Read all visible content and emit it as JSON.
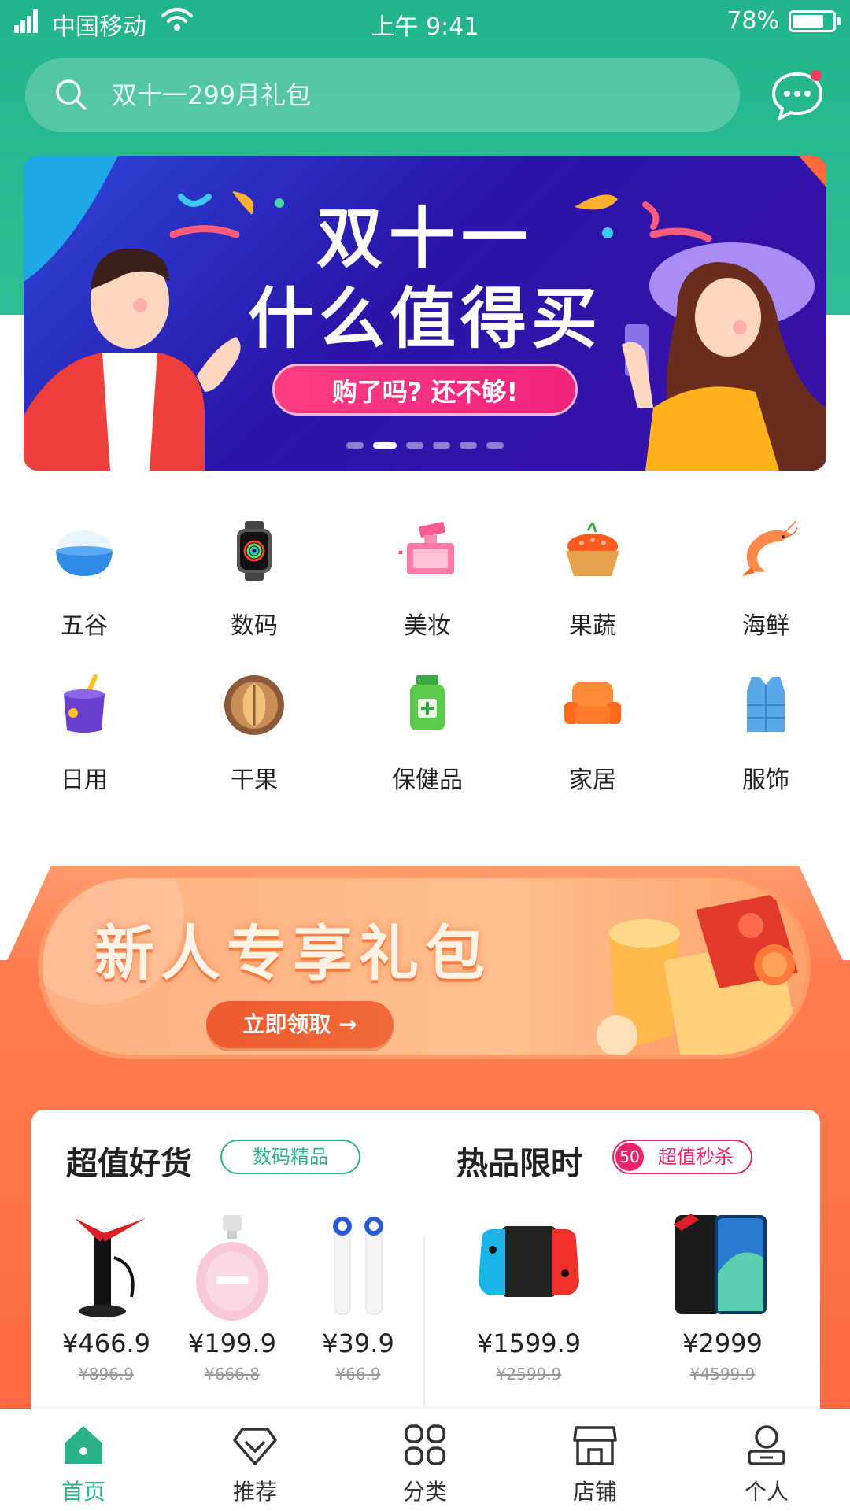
{
  "status_bar": {
    "carrier": "中国移动",
    "time": "上午 9:41",
    "battery": "78%"
  },
  "search": {
    "placeholder": "双十一299月礼包"
  },
  "banner": {
    "title": "双十一",
    "subtitle": "什么值得买",
    "button": "购了吗? 还不够!",
    "pages": 6,
    "active_page": 2
  },
  "categories": [
    {
      "label": "五谷",
      "icon": "rice-bowl-icon"
    },
    {
      "label": "数码",
      "icon": "smartwatch-icon"
    },
    {
      "label": "美妆",
      "icon": "perfume-icon"
    },
    {
      "label": "果蔬",
      "icon": "fruit-basket-icon"
    },
    {
      "label": "海鲜",
      "icon": "shrimp-icon"
    },
    {
      "label": "日用",
      "icon": "cup-icon"
    },
    {
      "label": "干果",
      "icon": "walnut-icon"
    },
    {
      "label": "保健品",
      "icon": "medicine-bottle-icon"
    },
    {
      "label": "家居",
      "icon": "sofa-icon"
    },
    {
      "label": "服饰",
      "icon": "vest-icon"
    }
  ],
  "promo": {
    "title": "新人专享礼包",
    "button": "立即领取 →"
  },
  "sections": {
    "left": {
      "title": "超值好货",
      "tag": "数码精品"
    },
    "right": {
      "title": "热品限时",
      "tag_badge": "50",
      "tag": "超值秒杀"
    }
  },
  "products": [
    {
      "price": "¥466.9",
      "old_price": "¥896.9"
    },
    {
      "price": "¥199.9",
      "old_price": "¥666.8"
    },
    {
      "price": "¥39.9",
      "old_price": "¥66.9"
    },
    {
      "price": "¥1599.9",
      "old_price": "¥2599.9"
    },
    {
      "price": "¥2999",
      "old_price": "¥4599.9"
    }
  ],
  "tabbar": {
    "items": [
      {
        "label": "首页",
        "icon": "home-icon",
        "active": true
      },
      {
        "label": "推荐",
        "icon": "diamond-icon",
        "active": false
      },
      {
        "label": "分类",
        "icon": "grid-icon",
        "active": false
      },
      {
        "label": "店铺",
        "icon": "store-icon",
        "active": false
      },
      {
        "label": "个人",
        "icon": "user-icon",
        "active": false
      }
    ]
  },
  "colors": {
    "brand_green": "#2bb28a",
    "accent_red": "#f0246c",
    "promo_orange": "#ff7d50"
  }
}
